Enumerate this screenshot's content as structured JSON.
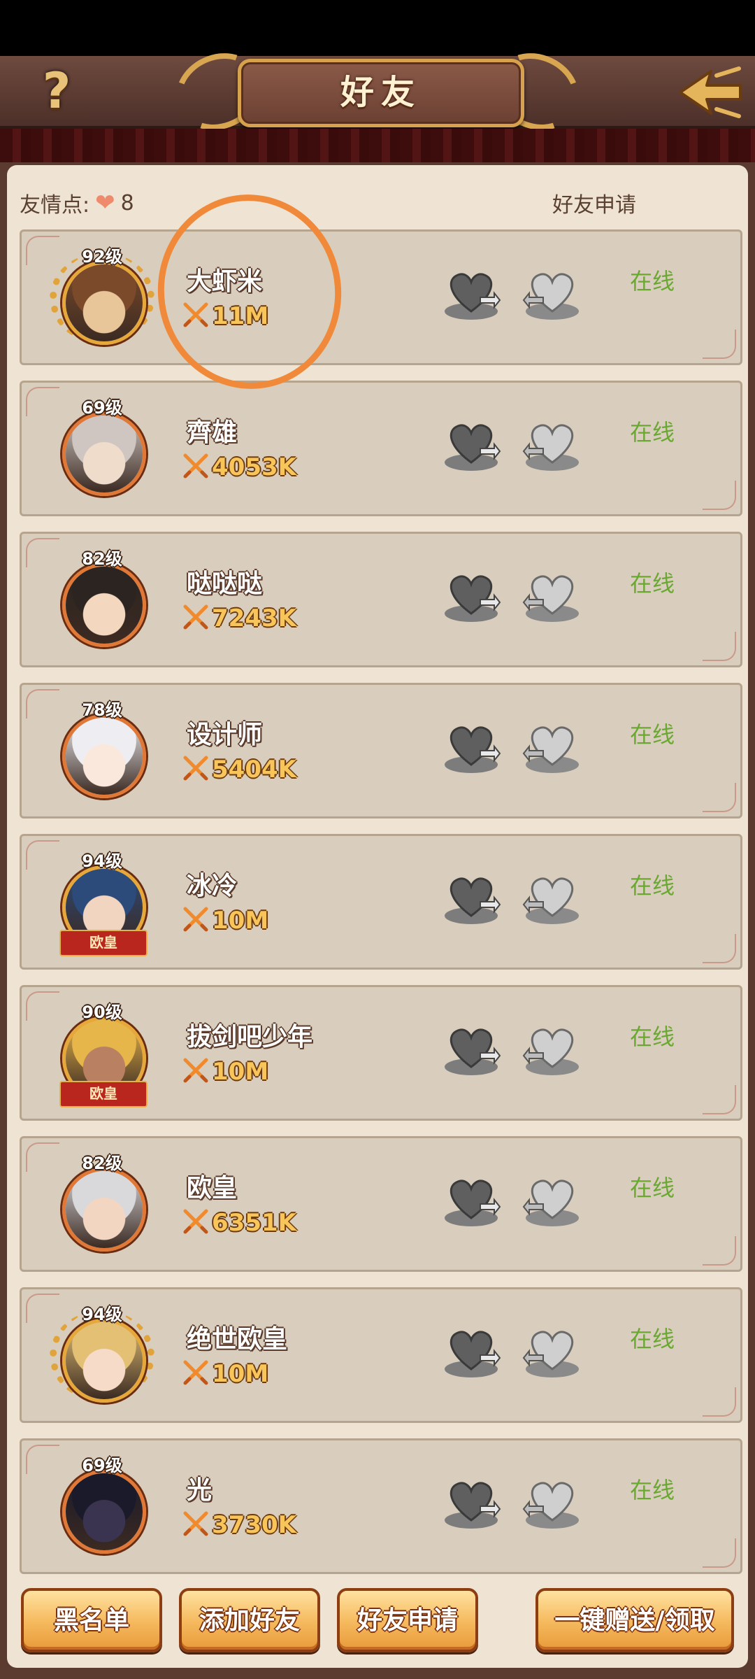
{
  "header": {
    "title": "好友",
    "help_label": "?"
  },
  "summary": {
    "friend_points_label": "友情点:",
    "friend_points_value": "8",
    "friend_requests_link": "好友申请"
  },
  "friends": [
    {
      "level": "92级",
      "name": "大虾米",
      "power": "11M",
      "status": "在线",
      "frame": "laurel",
      "face": "#e9c59a",
      "hair": "#7a4a2a"
    },
    {
      "level": "69级",
      "name": "齊雄",
      "power": "4053K",
      "status": "在线",
      "frame": "plain",
      "face": "#f0dccb",
      "hair": "#cfc6c2"
    },
    {
      "level": "82级",
      "name": "哒哒哒",
      "power": "7243K",
      "status": "在线",
      "frame": "plain",
      "face": "#f3d7bf",
      "hair": "#2b2420"
    },
    {
      "level": "78级",
      "name": "设计师",
      "power": "5404K",
      "status": "在线",
      "frame": "plain",
      "face": "#fbe8dc",
      "hair": "#eeeef2"
    },
    {
      "level": "94级",
      "name": "冰冷",
      "power": "10M",
      "status": "在线",
      "frame": "ribbon",
      "ribbon": "欧皇",
      "face": "#f1d5c0",
      "hair": "#2c4a7a"
    },
    {
      "level": "90级",
      "name": "拔剑吧少年",
      "power": "10M",
      "status": "在线",
      "frame": "ribbon",
      "ribbon": "欧皇",
      "face": "#b98062",
      "hair": "#e7b64a"
    },
    {
      "level": "82级",
      "name": "欧皇",
      "power": "6351K",
      "status": "在线",
      "frame": "plain",
      "face": "#f2d6c2",
      "hair": "#d9d9dc"
    },
    {
      "level": "94级",
      "name": "绝世欧皇",
      "power": "10M",
      "status": "在线",
      "frame": "laurel",
      "face": "#f6dcc8",
      "hair": "#e3c074"
    },
    {
      "level": "69级",
      "name": "光",
      "power": "3730K",
      "status": "在线",
      "frame": "plain",
      "face": "#3a3450",
      "hair": "#1a1a2a"
    }
  ],
  "buttons": {
    "blacklist": "黑名单",
    "add_friend": "添加好友",
    "friend_requests": "好友申请",
    "send_receive_all": "一键赠送/领取"
  },
  "colors": {
    "online": "#6aa832",
    "power": "#f7c55a",
    "panel": "#efe4d3",
    "row": "#d9cebd",
    "annotation": "#f08a3a"
  },
  "icons": {
    "help": "question-mark-icon",
    "back": "back-arrow-icon",
    "friend_points": "heart-icon",
    "power": "crossed-swords-icon",
    "send": "gift-heart-send-icon",
    "receive": "gift-heart-receive-icon"
  }
}
